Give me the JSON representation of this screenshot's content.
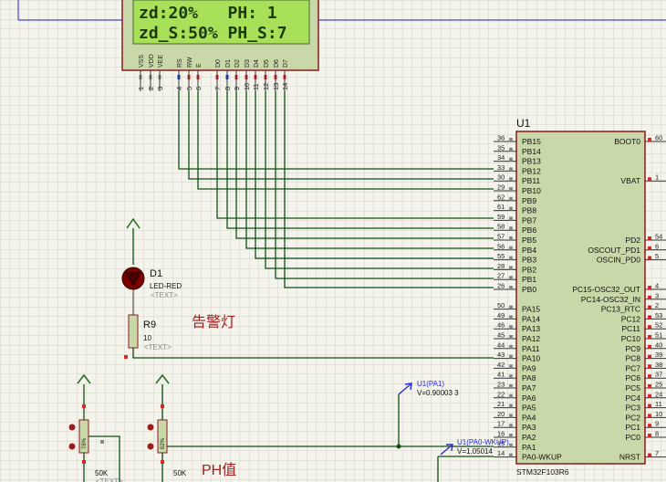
{
  "lcd": {
    "line1": "zd:20%   PH: 1",
    "line2": "zd_S:50% PH_S:7",
    "pins": [
      {
        "name": "VSS",
        "num": "1"
      },
      {
        "name": "VDD",
        "num": "2"
      },
      {
        "name": "VEE",
        "num": "3"
      },
      {
        "name": "RS",
        "num": "4"
      },
      {
        "name": "RW",
        "num": "5"
      },
      {
        "name": "E",
        "num": "6"
      },
      {
        "name": "D0",
        "num": "7"
      },
      {
        "name": "D1",
        "num": "8"
      },
      {
        "name": "D2",
        "num": "9"
      },
      {
        "name": "D3",
        "num": "10"
      },
      {
        "name": "D4",
        "num": "11"
      },
      {
        "name": "D5",
        "num": "12"
      },
      {
        "name": "D6",
        "num": "13"
      },
      {
        "name": "D7",
        "num": "14"
      }
    ]
  },
  "mcu": {
    "ref": "U1",
    "part": "STM32F103R6",
    "left_pins": [
      {
        "num": "36",
        "name": "PB15"
      },
      {
        "num": "35",
        "name": "PB14"
      },
      {
        "num": "34",
        "name": "PB13"
      },
      {
        "num": "33",
        "name": "PB12"
      },
      {
        "num": "30",
        "name": "PB11"
      },
      {
        "num": "29",
        "name": "PB10"
      },
      {
        "num": "62",
        "name": "PB9"
      },
      {
        "num": "61",
        "name": "PB8"
      },
      {
        "num": "59",
        "name": "PB7"
      },
      {
        "num": "58",
        "name": "PB6"
      },
      {
        "num": "57",
        "name": "PB5"
      },
      {
        "num": "56",
        "name": "PB4"
      },
      {
        "num": "55",
        "name": "PB3"
      },
      {
        "num": "28",
        "name": "PB2"
      },
      {
        "num": "27",
        "name": "PB1"
      },
      {
        "num": "26",
        "name": "PB0"
      },
      {
        "num": "",
        "name": ""
      },
      {
        "num": "50",
        "name": "PA15"
      },
      {
        "num": "49",
        "name": "PA14"
      },
      {
        "num": "46",
        "name": "PA13"
      },
      {
        "num": "45",
        "name": "PA12"
      },
      {
        "num": "44",
        "name": "PA11"
      },
      {
        "num": "43",
        "name": "PA10"
      },
      {
        "num": "42",
        "name": "PA9"
      },
      {
        "num": "41",
        "name": "PA8"
      },
      {
        "num": "23",
        "name": "PA7"
      },
      {
        "num": "22",
        "name": "PA6"
      },
      {
        "num": "21",
        "name": "PA5"
      },
      {
        "num": "20",
        "name": "PA4"
      },
      {
        "num": "17",
        "name": "PA3"
      },
      {
        "num": "16",
        "name": "PA2"
      },
      {
        "num": "15",
        "name": "PA1"
      },
      {
        "num": "14",
        "name": "PA0-WKUP"
      }
    ],
    "right_pins": [
      {
        "num": "60",
        "name": "BOOT0"
      },
      {
        "num": "",
        "name": ""
      },
      {
        "num": "",
        "name": ""
      },
      {
        "num": "",
        "name": ""
      },
      {
        "num": "1",
        "name": "VBAT"
      },
      {
        "num": "",
        "name": ""
      },
      {
        "num": "",
        "name": ""
      },
      {
        "num": "",
        "name": ""
      },
      {
        "num": "",
        "name": ""
      },
      {
        "num": "",
        "name": ""
      },
      {
        "num": "54",
        "name": "PD2"
      },
      {
        "num": "6",
        "name": "OSCOUT_PD1"
      },
      {
        "num": "5",
        "name": "OSCIN_PD0"
      },
      {
        "num": "",
        "name": ""
      },
      {
        "num": "",
        "name": ""
      },
      {
        "num": "4",
        "name": "PC15-OSC32_OUT"
      },
      {
        "num": "3",
        "name": "PC14-OSC32_IN"
      },
      {
        "num": "2",
        "name": "PC13_RTC"
      },
      {
        "num": "53",
        "name": "PC12"
      },
      {
        "num": "52",
        "name": "PC11"
      },
      {
        "num": "51",
        "name": "PC10"
      },
      {
        "num": "40",
        "name": "PC9"
      },
      {
        "num": "39",
        "name": "PC8"
      },
      {
        "num": "38",
        "name": "PC7"
      },
      {
        "num": "37",
        "name": "PC6"
      },
      {
        "num": "25",
        "name": "PC5"
      },
      {
        "num": "24",
        "name": "PC4"
      },
      {
        "num": "11",
        "name": "PC3"
      },
      {
        "num": "10",
        "name": "PC2"
      },
      {
        "num": "9",
        "name": "PC1"
      },
      {
        "num": "8",
        "name": "PC0"
      },
      {
        "num": "",
        "name": ""
      },
      {
        "num": "7",
        "name": "NRST"
      }
    ]
  },
  "d1": {
    "ref": "D1",
    "value": "LED-RED",
    "text": "<TEXT>"
  },
  "r9": {
    "ref": "R9",
    "value": "10",
    "text": "<TEXT>"
  },
  "alarm_label": "告警灯",
  "ph_label": "PH值",
  "probe1": {
    "name": "U1(PA1)",
    "value": "V=0.90003 3"
  },
  "probe2": {
    "name": "U1(PA0-WKUP)",
    "value": "V=1.05014"
  },
  "pot1": {
    "label": "78%",
    "value": "50K",
    "text": "<TEXT>"
  },
  "pot2": {
    "label": "62%",
    "value": "50K"
  },
  "colors": {
    "background": "#f4f4ec",
    "grid": "#d2d2c6",
    "wire": "#0f4f14",
    "component_body": "#c8d8a8",
    "component_border": "#8a1c1c",
    "lcd_screen": "#a8e05a",
    "lcd_text": "#1c3a0c",
    "pin_red": "#d62828",
    "pin_blue": "#1e40c8",
    "pin_gray": "#8a8a8a",
    "label_red": "#a02020"
  }
}
